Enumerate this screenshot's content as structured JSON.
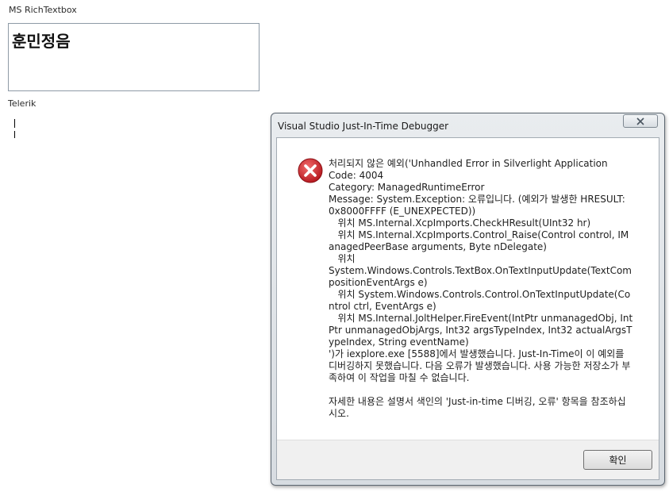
{
  "page": {
    "ms_label": "MS RichTextbox",
    "rich_textbox_value": "훈민정음",
    "telerik_label": "Telerik"
  },
  "dialog": {
    "title": "Visual Studio Just-In-Time Debugger",
    "icon": "error-icon",
    "message": "처리되지 않은 예외('Unhandled Error in Silverlight Application\nCode: 4004\nCategory: ManagedRuntimeError\nMessage: System.Exception: 오류입니다. (예외가 발생한 HRESULT: 0x8000FFFF (E_UNEXPECTED))\n   위치 MS.Internal.XcpImports.CheckHResult(UInt32 hr)\n   위치 MS.Internal.XcpImports.Control_Raise(Control control, IManagedPeerBase arguments, Byte nDelegate)\n   위치\nSystem.Windows.Controls.TextBox.OnTextInputUpdate(TextCompositionEventArgs e)\n   위치 System.Windows.Controls.Control.OnTextInputUpdate(Control ctrl, EventArgs e)\n   위치 MS.Internal.JoltHelper.FireEvent(IntPtr unmanagedObj, IntPtr unmanagedObjArgs, Int32 argsTypeIndex, Int32 actualArgsTypeIndex, String eventName)\n')가 iexplore.exe [5588]에서 발생했습니다. Just-In-Time이 이 예외를 디버깅하지 못했습니다. 다음 오류가 발생했습니다. 사용 가능한 저장소가 부족하여 이 작업을 마칠 수 없습니다.\n\n자세한 내용은 설명서 색인의 'Just-in-time 디버깅, 오류' 항목을 참조하십시오.",
    "ok_label": "확인"
  },
  "colors": {
    "error_red": "#d32f2f",
    "dialog_bg": "#f0f0f0"
  }
}
